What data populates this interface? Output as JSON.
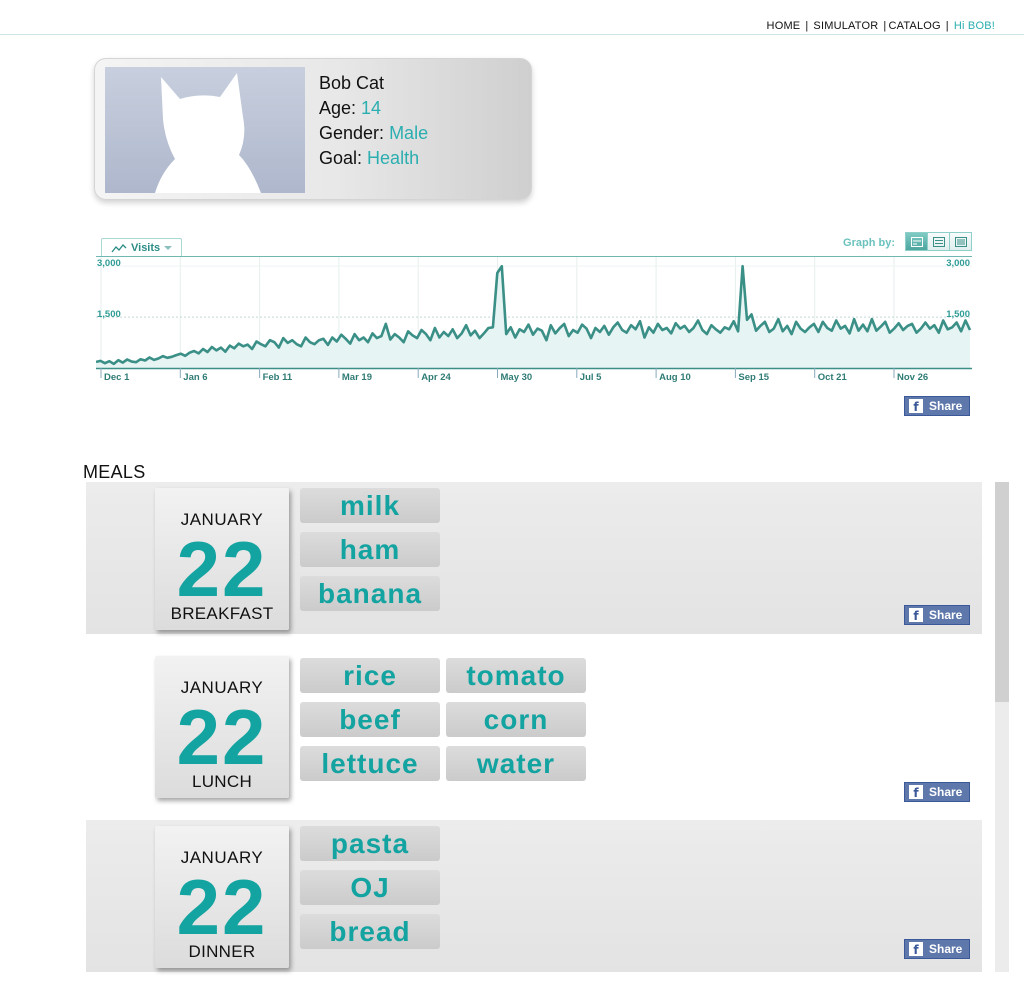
{
  "nav": {
    "home": "HOME",
    "simulator": "SIMULATOR",
    "catalog": "CATALOG",
    "greeting": "Hi BOB!",
    "separator": "|"
  },
  "profile": {
    "name": "Bob Cat",
    "age_label": "Age:",
    "age": "14",
    "gender_label": "Gender:",
    "gender": "Male",
    "goal_label": "Goal:",
    "goal": "Health"
  },
  "graph": {
    "tab_label": "Visits",
    "graph_by_label": "Graph by:",
    "graph_by_options": [
      "day",
      "week",
      "month"
    ],
    "graph_by_selected": "day"
  },
  "chart_data": {
    "type": "area",
    "x_tick_labels": [
      "Dec 1",
      "Jan 6",
      "Feb 11",
      "Mar 19",
      "Apr 24",
      "May 30",
      "Jul 5",
      "Aug 10",
      "Sep 15",
      "Oct 21",
      "Nov 26"
    ],
    "y_tick_labels_left": [
      "3,000",
      "1,500"
    ],
    "y_tick_labels_right": [
      "3,000",
      "1,500"
    ],
    "ylim": [
      0,
      3000
    ],
    "series": [
      {
        "values": [
          180,
          210,
          140,
          200,
          120,
          230,
          160,
          250,
          190,
          170,
          260,
          220,
          310,
          240,
          280,
          350,
          300,
          330,
          380,
          420,
          360,
          450,
          500,
          430,
          560,
          470,
          620,
          520,
          600,
          480,
          660,
          580,
          720,
          640,
          690,
          560,
          780,
          700,
          640,
          820,
          760,
          600,
          880,
          740,
          820,
          700,
          640,
          900,
          760,
          700,
          820,
          860,
          680,
          900,
          780,
          980,
          860,
          720,
          1000,
          820,
          900,
          760,
          1020,
          880,
          940,
          1300,
          840,
          1000,
          900,
          760,
          1080,
          960,
          880,
          1120,
          1000,
          820,
          1180,
          900,
          1060,
          940,
          1140,
          880,
          1020,
          1260,
          960,
          1100,
          880,
          1020,
          1180,
          1200,
          2800,
          3000,
          1000,
          1200,
          900,
          1140,
          1060,
          1280,
          980,
          1160,
          1100,
          820,
          1260,
          1020,
          1180,
          1300,
          940,
          1120,
          1040,
          1280,
          1160,
          880,
          1180,
          1060,
          1240,
          980,
          1200,
          1340,
          1120,
          1040,
          1260,
          1140,
          1380,
          900,
          1200,
          1040,
          1300,
          1120,
          1180,
          1020,
          1320,
          1160,
          1240,
          1060,
          1180,
          1400,
          1120,
          1000,
          1260,
          1140,
          1040,
          1200,
          1140,
          1380,
          1080,
          3000,
          1420,
          1580,
          1100,
          1240,
          1360,
          1060,
          1160,
          1440,
          1080,
          1240,
          1000,
          1360,
          1160,
          1060,
          1200,
          1300,
          1060,
          1360,
          1180,
          1100,
          1400,
          1160,
          1240,
          1020,
          1440,
          1100,
          1280,
          1080,
          1440,
          1100,
          1220,
          1360,
          1040,
          1160,
          1320,
          1120,
          1240,
          1300,
          1040,
          1160,
          1340,
          1160,
          1260,
          1040,
          1400,
          1140,
          1200,
          1340,
          1080,
          1400,
          1120
        ]
      }
    ],
    "grid": true,
    "line_color": "#3a8f86",
    "fill_color": "#e6f4f3"
  },
  "share_label": "Share",
  "meals": {
    "title": "MEALS",
    "entries": [
      {
        "month": "JANUARY",
        "day": "22",
        "meal": "BREAKFAST",
        "foods": [
          "milk",
          "ham",
          "banana"
        ]
      },
      {
        "month": "JANUARY",
        "day": "22",
        "meal": "LUNCH",
        "foods": [
          "rice",
          "beef",
          "lettuce",
          "tomato",
          "corn",
          "water"
        ]
      },
      {
        "month": "JANUARY",
        "day": "22",
        "meal": "DINNER",
        "foods": [
          "pasta",
          "OJ",
          "bread"
        ]
      }
    ]
  },
  "colors": {
    "accent": "#2aaeb0",
    "food_text": "#13a3a0",
    "facebook": "#3b5998"
  }
}
